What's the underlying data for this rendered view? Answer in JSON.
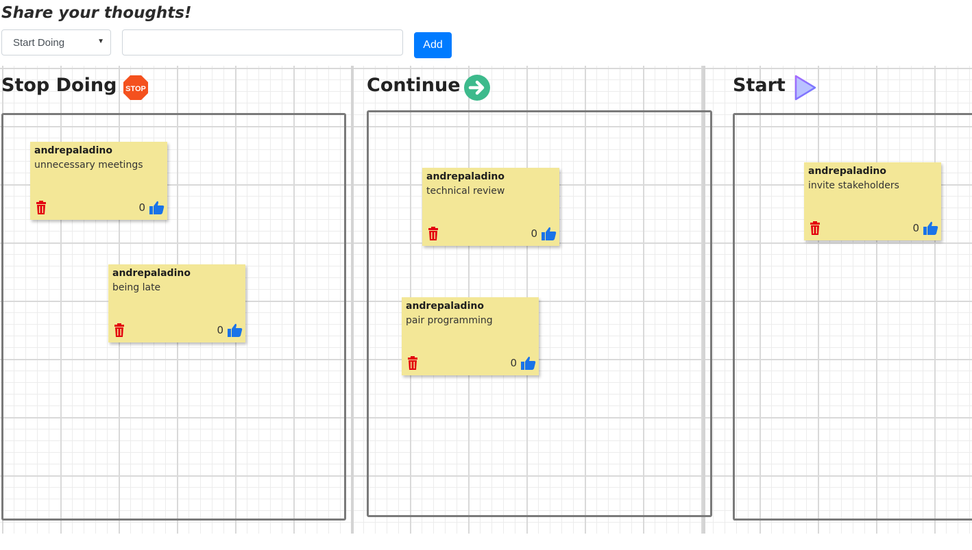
{
  "header": {
    "title": "Share your thoughts!",
    "category_select": "Start Doing",
    "input_value": "",
    "add_label": "Add"
  },
  "columns": [
    {
      "title": "Stop Doing",
      "icon": "stop-sign-icon",
      "icon_label": "STOP",
      "notes": [
        {
          "author": "andrepaladino",
          "text": "unnecessary meetings",
          "likes": "0"
        },
        {
          "author": "andrepaladino",
          "text": "being late",
          "likes": "0"
        }
      ]
    },
    {
      "title": "Continue",
      "icon": "arrow-right-circle-icon",
      "notes": [
        {
          "author": "andrepaladino",
          "text": "technical review",
          "likes": "0"
        },
        {
          "author": "andrepaladino",
          "text": "pair programming",
          "likes": "0"
        }
      ]
    },
    {
      "title": "Start",
      "icon": "play-icon",
      "notes": [
        {
          "author": "andrepaladino",
          "text": "invite stakeholders",
          "likes": "0"
        }
      ]
    }
  ],
  "colors": {
    "note": "#f3e797",
    "accent": "#007bff",
    "delete": "#e3000f",
    "like": "#1a73e8",
    "stop": "#f4511e",
    "continue": "#3dba8c"
  }
}
